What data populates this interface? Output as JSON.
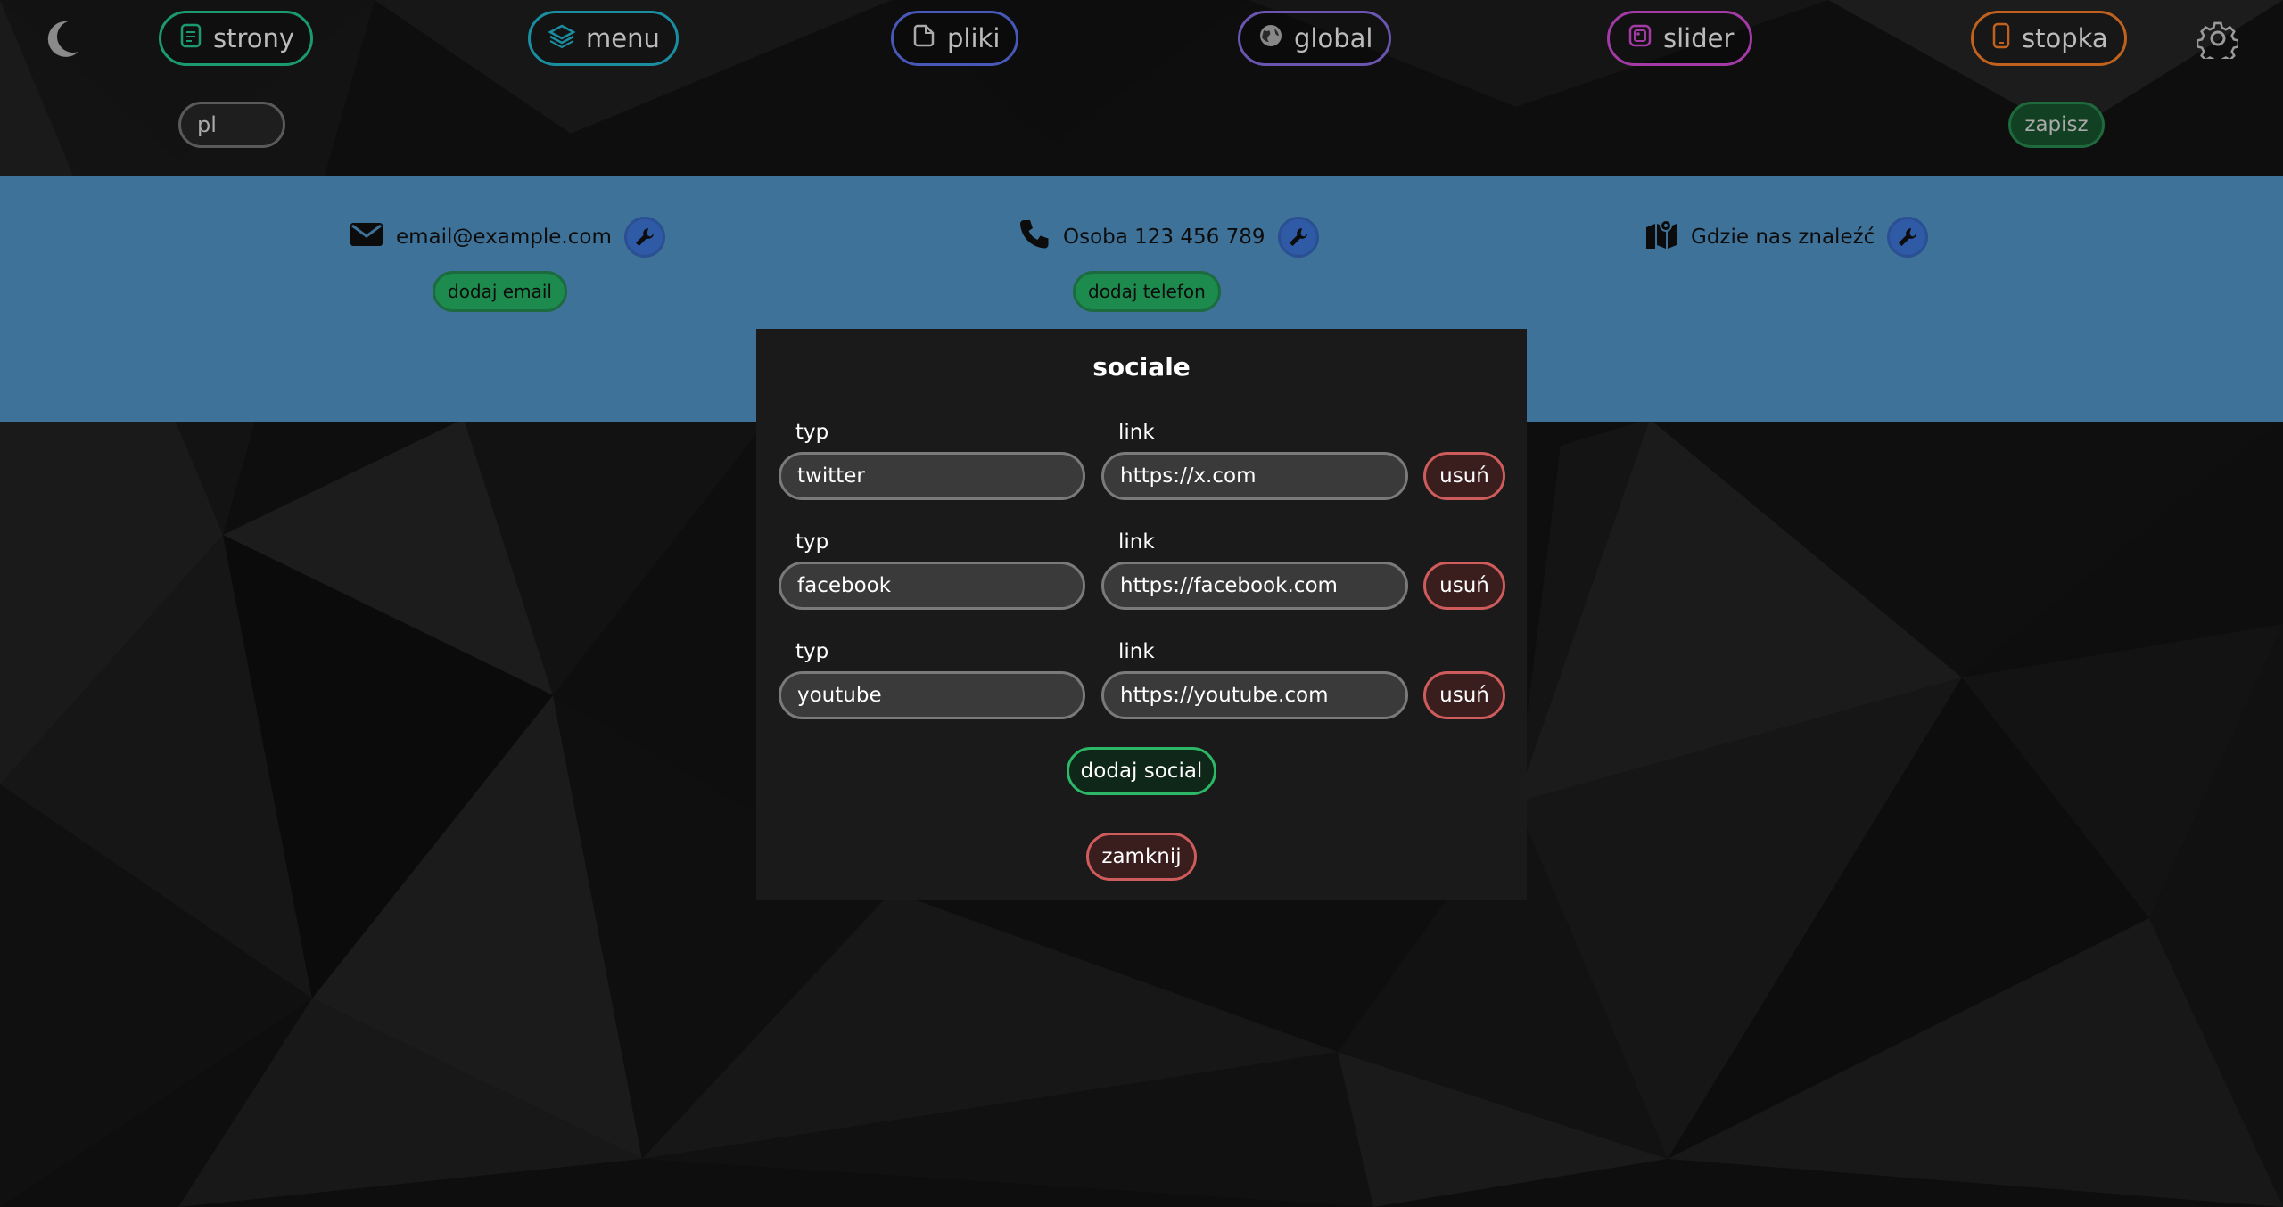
{
  "nav": {
    "items": [
      {
        "label": "strony",
        "icon": "document-icon",
        "color": "#1a9a6e"
      },
      {
        "label": "menu",
        "icon": "layers-icon",
        "color": "#1a8ea0"
      },
      {
        "label": "pliki",
        "icon": "file-icon",
        "color": "#4858b8"
      },
      {
        "label": "global",
        "icon": "globe-icon",
        "color": "#6a55b0"
      },
      {
        "label": "slider",
        "icon": "image-icon",
        "color": "#a33aa5"
      },
      {
        "label": "stopka",
        "icon": "phone-device-icon",
        "color": "#c0621e"
      }
    ],
    "theme_icon": "moon-icon",
    "settings_icon": "gear-icon"
  },
  "language": {
    "value": "pl"
  },
  "save_label": "zapisz",
  "contacts": {
    "email": {
      "text": "email@example.com",
      "icon": "envelope-icon",
      "add_label": "dodaj email"
    },
    "phone": {
      "text": "Osoba 123 456 789",
      "icon": "phone-icon",
      "add_label": "dodaj telefon"
    },
    "location": {
      "text": "Gdzie nas znaleźć",
      "icon": "map-icon"
    },
    "edit_icon": "wrench-icon"
  },
  "modal": {
    "title": "sociale",
    "type_label": "typ",
    "link_label": "link",
    "rows": [
      {
        "type": "twitter",
        "link": "https://x.com"
      },
      {
        "type": "facebook",
        "link": "https://facebook.com"
      },
      {
        "type": "youtube",
        "link": "https://youtube.com"
      }
    ],
    "delete_label": "usuń",
    "add_label": "dodaj social",
    "close_label": "zamknij"
  },
  "colors": {
    "band": "#3e7298",
    "accent_green": "#2cb866",
    "accent_red": "#cf5c5c",
    "modal_bg": "#1a1a1a"
  }
}
